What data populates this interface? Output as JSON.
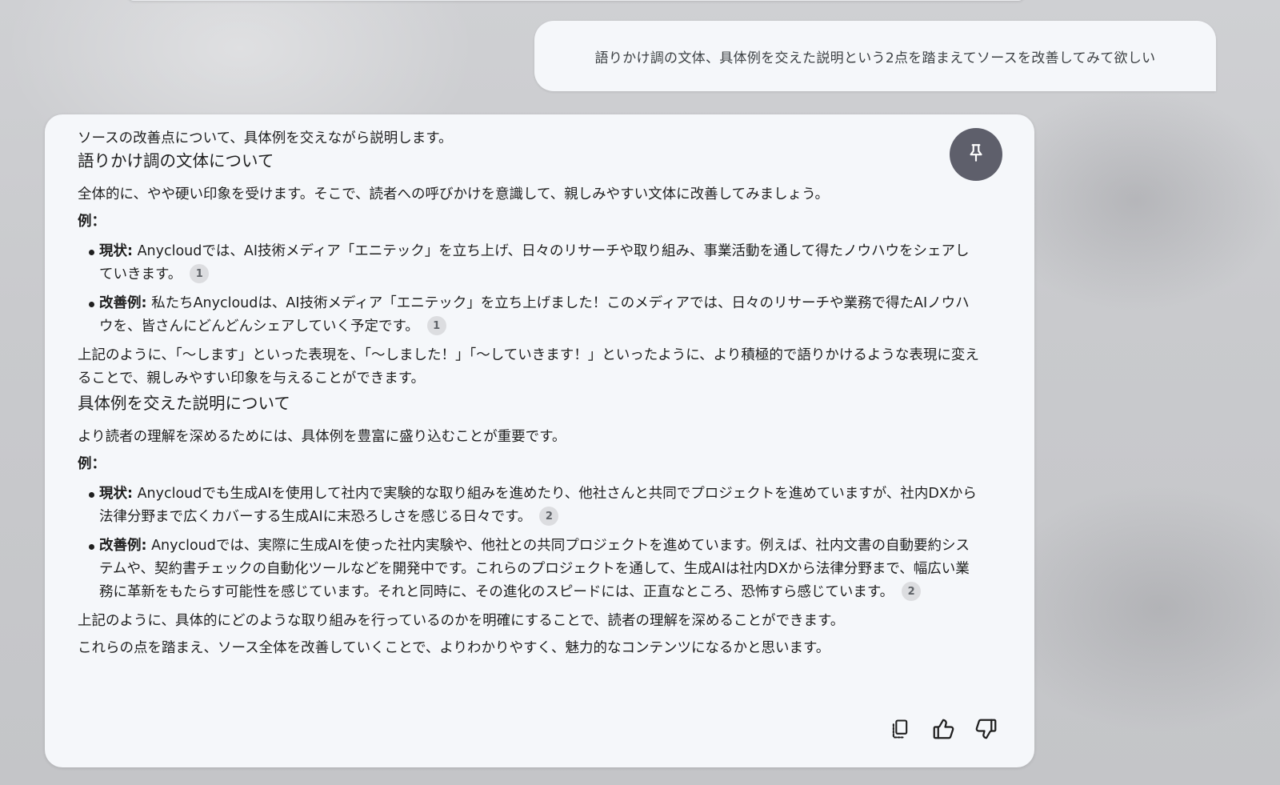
{
  "user_message": {
    "text": "語りかけ調の文体、具体例を交えた説明という2点を踏まえてソースを改善してみて欲しい"
  },
  "response": {
    "intro": "ソースの改善点について、具体例を交えながら説明します。",
    "sections": [
      {
        "heading": "語りかけ調の文体について",
        "lead": "全体的に、やや硬い印象を受けます。そこで、読者への呼びかけを意識して、親しみやすい文体に改善してみましょう。",
        "example_label": "例：",
        "items": [
          {
            "label": "現状:",
            "text": " Anycloudでは、AI技術メディア「エニテック」を立ち上げ、日々のリサーチや取り組み、事業活動を通して得たノウハウをシェアしていきます。",
            "cite": "1"
          },
          {
            "label": "改善例:",
            "text": " 私たちAnycloudは、AI技術メディア「エニテック」を立ち上げました！このメディアでは、日々のリサーチや業務で得たAIノウハウを、皆さんにどんどんシェアしていく予定です。",
            "cite": "1"
          }
        ],
        "conclusion": "上記のように、「～します」といった表現を、「～しました！」「～していきます！」といったように、より積極的で語りかけるような表現に変えることで、親しみやすい印象を与えることができます。"
      },
      {
        "heading": "具体例を交えた説明について",
        "lead": "より読者の理解を深めるためには、具体例を豊富に盛り込むことが重要です。",
        "example_label": "例：",
        "items": [
          {
            "label": "現状:",
            "text": " Anycloudでも生成AIを使用して社内で実験的な取り組みを進めたり、他社さんと共同でプロジェクトを進めていますが、社内DXから法律分野まで広くカバーする生成AIに末恐ろしさを感じる日々です。",
            "cite": "2"
          },
          {
            "label": "改善例:",
            "text": " Anycloudでは、実際に生成AIを使った社内実験や、他社との共同プロジェクトを進めています。例えば、社内文書の自動要約システムや、契約書チェックの自動化ツールなどを開発中です。これらのプロジェクトを通して、生成AIは社内DXから法律分野まで、幅広い業務に革新をもたらす可能性を感じています。それと同時に、その進化のスピードには、正直なところ、恐怖すら感じています。",
            "cite": "2"
          }
        ],
        "conclusion": "上記のように、具体的にどのような取り組みを行っているのかを明確にすることで、読者の理解を深めることができます。"
      }
    ],
    "closing": "これらの点を踏まえ、ソース全体を改善していくことで、よりわかりやすく、魅力的なコンテンツになるかと思います。"
  },
  "icons": {
    "pin": "pin-icon",
    "copy": "copy-icon",
    "thumbs_up": "thumbs-up-icon",
    "thumbs_down": "thumbs-down-icon"
  },
  "colors": {
    "background": "#c9cacd",
    "card": "#f5f7fa",
    "pin_button": "#5e5f6b",
    "citation_badge": "#dcdde0",
    "text": "#1f1f1f"
  }
}
